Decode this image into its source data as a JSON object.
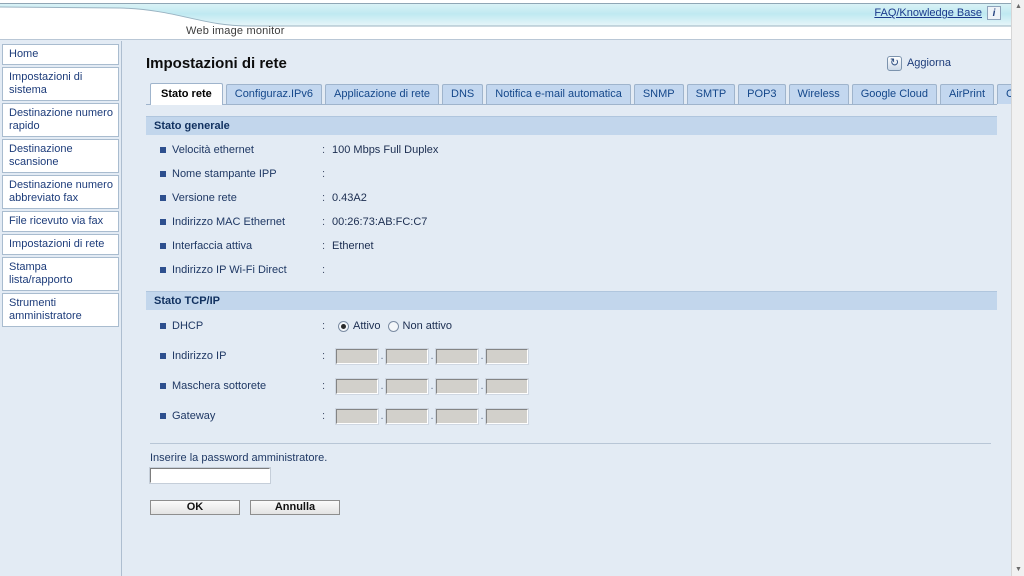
{
  "header": {
    "app_title": "Web image monitor",
    "faq_link": "FAQ/Knowledge Base",
    "faq_icon": "info-icon",
    "faq_icon_glyph": "i"
  },
  "sidebar": {
    "items": [
      {
        "label": "Home"
      },
      {
        "label": "Impostazioni di sistema"
      },
      {
        "label": "Destinazione numero rapido"
      },
      {
        "label": "Destinazione scansione"
      },
      {
        "label": "Destinazione numero abbreviato fax"
      },
      {
        "label": "File ricevuto via fax"
      },
      {
        "label": "Impostazioni di rete"
      },
      {
        "label": "Stampa lista/rapporto"
      },
      {
        "label": "Strumenti amministratore"
      }
    ]
  },
  "main": {
    "page_title": "Impostazioni di rete",
    "refresh": {
      "label": "Aggiorna",
      "icon": "refresh-icon",
      "icon_glyph": "↻"
    },
    "tabs": [
      {
        "label": "Stato rete",
        "active": true
      },
      {
        "label": "Configuraz.IPv6",
        "active": false
      },
      {
        "label": "Applicazione di rete",
        "active": false
      },
      {
        "label": "DNS",
        "active": false
      },
      {
        "label": "Notifica e-mail automatica",
        "active": false
      },
      {
        "label": "SNMP",
        "active": false
      },
      {
        "label": "SMTP",
        "active": false
      },
      {
        "label": "POP3",
        "active": false
      },
      {
        "label": "Wireless",
        "active": false
      },
      {
        "label": "Google Cloud",
        "active": false
      },
      {
        "label": "AirPrint",
        "active": false
      },
      {
        "label": "Certificate",
        "active": false
      }
    ],
    "sections": [
      {
        "title": "Stato generale",
        "rows": [
          {
            "label": "Velocità ethernet",
            "value": "100 Mbps Full Duplex"
          },
          {
            "label": "Nome stampante IPP",
            "value": ""
          },
          {
            "label": "Versione rete",
            "value": "0.43A2"
          },
          {
            "label": "Indirizzo MAC Ethernet",
            "value": "00:26:73:AB:FC:C7"
          },
          {
            "label": "Interfaccia attiva",
            "value": "Ethernet"
          },
          {
            "label": "Indirizzo IP Wi-Fi Direct",
            "value": ""
          }
        ]
      },
      {
        "title": "Stato TCP/IP",
        "dhcp": {
          "label": "DHCP",
          "options": [
            {
              "label": "Attivo",
              "selected": true
            },
            {
              "label": "Non attivo",
              "selected": false
            }
          ]
        },
        "ip_rows": [
          {
            "label": "Indirizzo IP",
            "octets": [
              "",
              "",
              "",
              ""
            ]
          },
          {
            "label": "Maschera sottorete",
            "octets": [
              "",
              "",
              "",
              ""
            ]
          },
          {
            "label": "Gateway",
            "octets": [
              "",
              "",
              "",
              ""
            ]
          }
        ],
        "separator": "."
      }
    ],
    "password": {
      "label": "Inserire la password amministratore.",
      "value": ""
    },
    "buttons": {
      "ok": "OK",
      "cancel": "Annulla"
    }
  },
  "scrollbar": {
    "up_glyph": "▲",
    "down_glyph": "▼"
  },
  "colors": {
    "page_bg": "#e3ebf4",
    "banner_accent": "#bfe9f0",
    "section_header": "#c2d6ec",
    "tab_inactive": "#c3d7ef",
    "link": "#1b3a8c",
    "label_text": "#1f3864"
  }
}
